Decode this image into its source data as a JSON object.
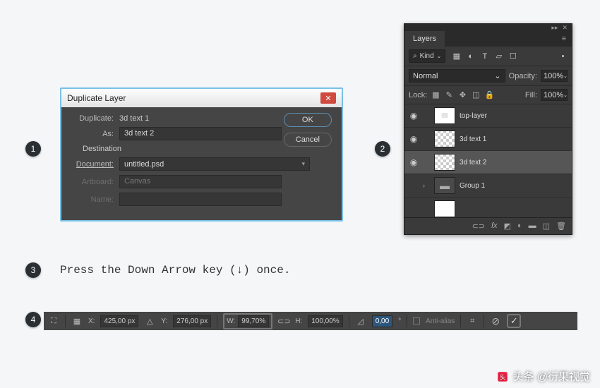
{
  "steps": {
    "s1": "1",
    "s2": "2",
    "s3": "3",
    "s4": "4"
  },
  "dialog": {
    "title": "Duplicate Layer",
    "duplicate_label": "Duplicate:",
    "duplicate_value": "3d text 1",
    "as_label": "As:",
    "as_value": "3d text 2",
    "destination_label": "Destination",
    "document_label": "Document:",
    "document_value": "untitled.psd",
    "artboard_label": "Artboard:",
    "artboard_value": "Canvas",
    "name_label": "Name:",
    "name_value": "",
    "ok": "OK",
    "cancel": "Cancel"
  },
  "layers_panel": {
    "tab": "Layers",
    "kind_label": "Kind",
    "blend_mode": "Normal",
    "opacity_label": "Opacity:",
    "opacity_value": "100%",
    "lock_label": "Lock:",
    "fill_label": "Fill:",
    "fill_value": "100%",
    "layers": [
      {
        "name": "top-layer"
      },
      {
        "name": "3d text 1"
      },
      {
        "name": "3d text 2"
      },
      {
        "name": "Group 1"
      }
    ],
    "fx_label": "fx"
  },
  "step3_text": "Press the Down Arrow key (↓) once.",
  "transform_bar": {
    "x_label": "X:",
    "x_value": "425,00 px",
    "y_label": "Y:",
    "y_value": "276,00 px",
    "w_label": "W:",
    "w_value": "99,70%",
    "h_label": "H:",
    "h_value": "100,00%",
    "angle_value": "0,00",
    "deg": "°",
    "anti_alias": "Anti-alias"
  },
  "watermark": "头条 @衍果视觉"
}
